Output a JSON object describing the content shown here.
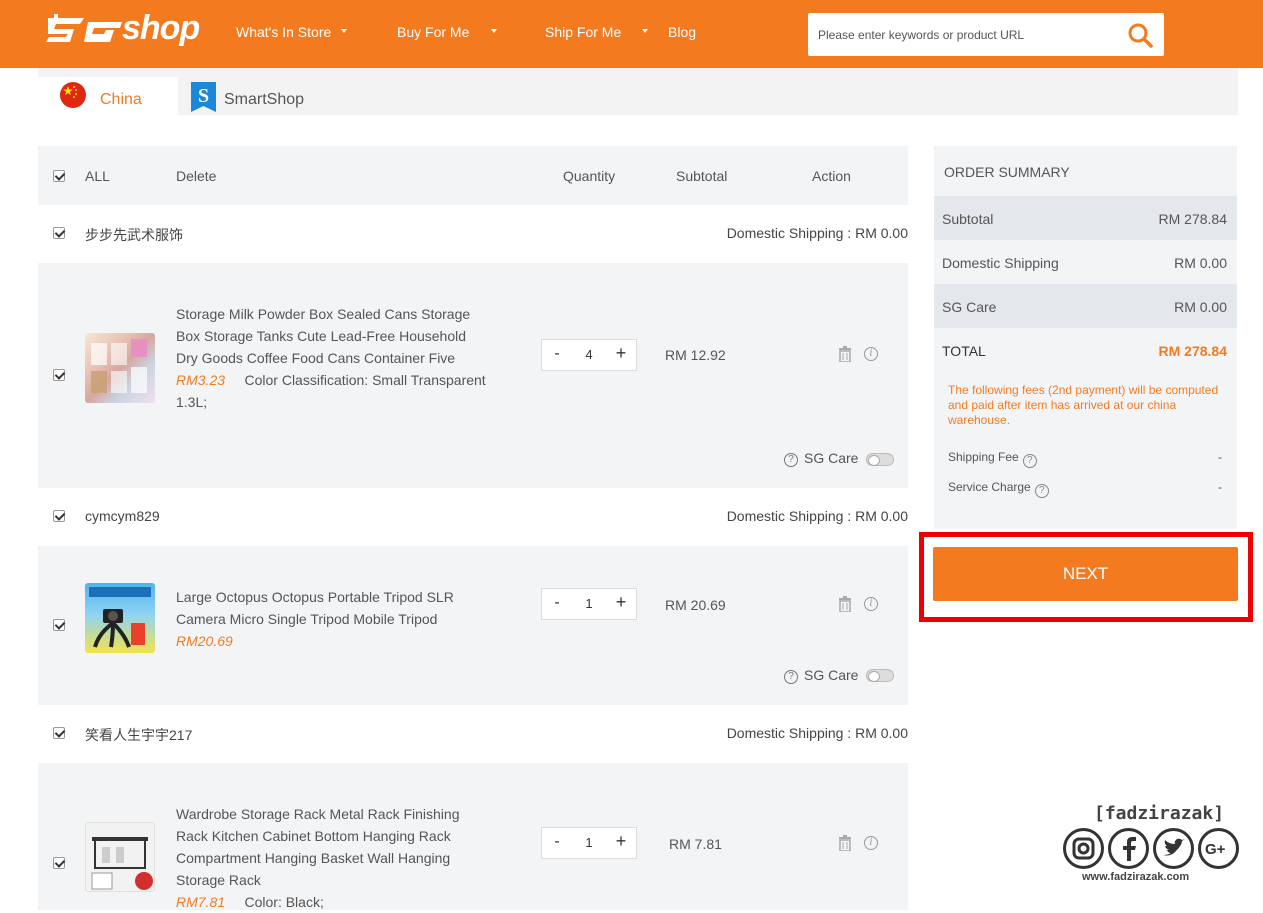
{
  "header": {
    "logo_text": "shop",
    "nav": [
      {
        "label": "What's In Store",
        "has_caret": true
      },
      {
        "label": "Buy For Me",
        "has_caret": true
      },
      {
        "label": "Ship For Me",
        "has_caret": true
      },
      {
        "label": "Blog",
        "has_caret": false
      }
    ],
    "search_placeholder": "Please enter keywords or product URL",
    "brand_color": "#f47a20"
  },
  "tabs": [
    {
      "label": "China",
      "icon": "china-flag-icon",
      "active": true,
      "color": "#f47a20"
    },
    {
      "label": "SmartShop",
      "icon": "smartshop-icon",
      "active": false
    }
  ],
  "cart_header": {
    "all": "ALL",
    "delete": "Delete",
    "quantity": "Quantity",
    "subtotal": "Subtotal",
    "action": "Action"
  },
  "shops": [
    {
      "name": "步步先武术服饰",
      "shipping": "Domestic Shipping : RM 0.00",
      "item": {
        "title": "Storage Milk Powder Box Sealed Cans Storage Box Storage Tanks Cute Lead-Free Household Dry Goods Coffee Food Cans Container Five",
        "price": "RM3.23",
        "variant": "Color Classification: Small Transparent 1.3L;",
        "qty": "4",
        "subtotal": "RM 12.92",
        "sg_care": "SG Care"
      }
    },
    {
      "name": "cymcym829",
      "shipping": "Domestic Shipping : RM 0.00",
      "item": {
        "title": "Large Octopus Octopus Portable Tripod SLR Camera Micro Single Tripod Mobile Tripod",
        "price": "RM20.69",
        "variant": "",
        "qty": "1",
        "subtotal": "RM 20.69",
        "sg_care": "SG Care"
      }
    },
    {
      "name": "笑看人生宇宇217",
      "shipping": "Domestic Shipping : RM 0.00",
      "item": {
        "title": "Wardrobe Storage Rack Metal Rack Finishing Rack Kitchen Cabinet Bottom Hanging Rack Compartment Hanging Basket Wall Hanging Storage Rack",
        "price": "RM7.81",
        "variant": "Color: Black;",
        "qty": "1",
        "subtotal": "RM 7.81"
      }
    }
  ],
  "qty_controls": {
    "minus": "-",
    "plus": "+"
  },
  "summary": {
    "title": "ORDER SUMMARY",
    "rows": [
      {
        "label": "Subtotal",
        "value": "RM 278.84"
      },
      {
        "label": "Domestic Shipping",
        "value": "RM 0.00"
      },
      {
        "label": "SG Care",
        "value": "RM 0.00"
      },
      {
        "label": "TOTAL",
        "value": "RM 278.84"
      }
    ],
    "note": "The following fees (2nd payment) will be computed and paid after item has arrived at our china warehouse.",
    "fees": [
      {
        "label": "Shipping Fee",
        "value": "-"
      },
      {
        "label": "Service Charge",
        "value": "-"
      }
    ],
    "next": "NEXT"
  },
  "watermark": {
    "name": "[fadzirazak]",
    "site": "www.fadzirazak.com",
    "icons": [
      "instagram-icon",
      "facebook-icon",
      "twitter-icon",
      "google-plus-icon"
    ]
  }
}
